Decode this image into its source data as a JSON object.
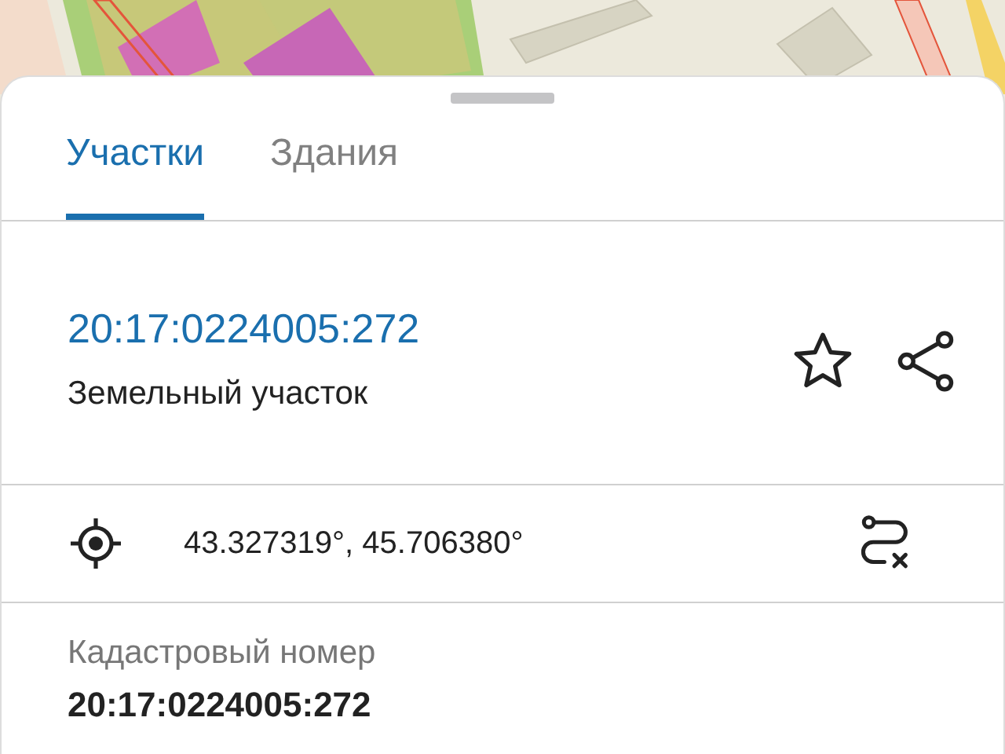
{
  "tabs": [
    {
      "label": "Участки",
      "selected": true
    },
    {
      "label": "Здания",
      "selected": false
    }
  ],
  "parcel": {
    "number": "20:17:0224005:272",
    "type": "Земельный участок",
    "favorite": false
  },
  "coordinates": "43.327319°, 45.706380°",
  "fields": [
    {
      "label": "Кадастровый номер",
      "value": "20:17:0224005:272"
    }
  ]
}
